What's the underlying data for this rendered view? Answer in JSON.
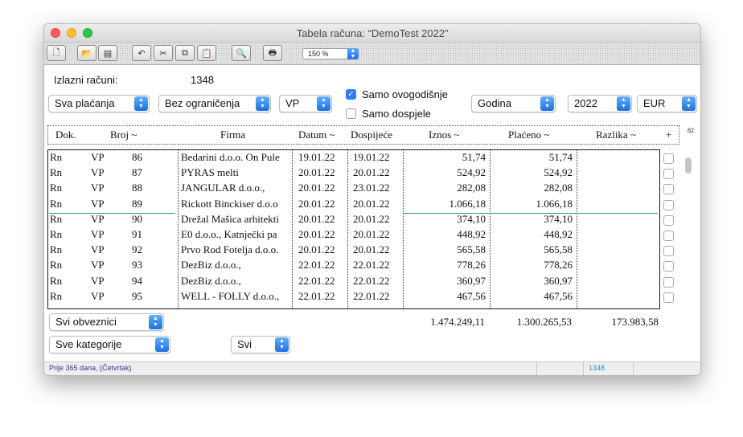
{
  "window": {
    "title": "Tabela računa: “DemoTest 2022”"
  },
  "toolbar": {
    "zoom": "150 %"
  },
  "summary": {
    "label": "Izlazni računi:",
    "count": "1348"
  },
  "filters": {
    "payment": "Sva plaćanja",
    "limit": "Bez ograničenja",
    "type": "VP",
    "period": "Godina",
    "year": "2022",
    "currency": "EUR",
    "cb_current_year": "Samo ovogodišnje",
    "cb_current_year_checked": true,
    "cb_due": "Samo dospjele",
    "cb_due_checked": false,
    "payers": "Svi obveznici",
    "categories": "Sve kategorije",
    "all": "Svi"
  },
  "columns": {
    "dok": "Dok.",
    "broj": "Broj ~",
    "firma": "Firma",
    "datum": "Datum ~",
    "dospijece": "Dospijeće",
    "iznos": "Iznos ~",
    "placeno": "Plaćeno ~",
    "razlika": "Razlika ~",
    "plus": "+",
    "count": "82"
  },
  "rows": [
    {
      "dok": "Rn",
      "vp": "VP",
      "broj": "86",
      "firma": "Bedarini d.o.o. On Pule",
      "datum": "19.01.22",
      "dosp": "19.01.22",
      "iznos": "51,74",
      "placeno": "51,74",
      "razlika": ""
    },
    {
      "dok": "Rn",
      "vp": "VP",
      "broj": "87",
      "firma": "PYRAS melti",
      "datum": "20.01.22",
      "dosp": "20.01.22",
      "iznos": "524,92",
      "placeno": "524,92",
      "razlika": ""
    },
    {
      "dok": "Rn",
      "vp": "VP",
      "broj": "88",
      "firma": "JANGULAR d.o.o.,",
      "datum": "20.01.22",
      "dosp": "23.01.22",
      "iznos": "282,08",
      "placeno": "282,08",
      "razlika": ""
    },
    {
      "dok": "Rn",
      "vp": "VP",
      "broj": "89",
      "firma": "Rickott Binckiser d.o.o",
      "datum": "20.01.22",
      "dosp": "20.01.22",
      "iznos": "1.066,18",
      "placeno": "1.066,18",
      "razlika": ""
    },
    {
      "dok": "Rn",
      "vp": "VP",
      "broj": "90",
      "firma": "Drežal Mašica arhitekti",
      "datum": "20.01.22",
      "dosp": "20.01.22",
      "iznos": "374,10",
      "placeno": "374,10",
      "razlika": ""
    },
    {
      "dok": "Rn",
      "vp": "VP",
      "broj": "91",
      "firma": "E0 d.o.o., Katnječki pa",
      "datum": "20.01.22",
      "dosp": "20.01.22",
      "iznos": "448,92",
      "placeno": "448,92",
      "razlika": ""
    },
    {
      "dok": "Rn",
      "vp": "VP",
      "broj": "92",
      "firma": "Prvo Rod Fotelja d.o.o.",
      "datum": "20.01.22",
      "dosp": "20.01.22",
      "iznos": "565,58",
      "placeno": "565,58",
      "razlika": ""
    },
    {
      "dok": "Rn",
      "vp": "VP",
      "broj": "93",
      "firma": "DezBiz d.o.o.,",
      "datum": "22.01.22",
      "dosp": "22.01.22",
      "iznos": "778,26",
      "placeno": "778,26",
      "razlika": ""
    },
    {
      "dok": "Rn",
      "vp": "VP",
      "broj": "94",
      "firma": "DezBiz d.o.o.,",
      "datum": "22.01.22",
      "dosp": "22.01.22",
      "iznos": "360,97",
      "placeno": "360,97",
      "razlika": ""
    },
    {
      "dok": "Rn",
      "vp": "VP",
      "broj": "95",
      "firma": "WELL - FOLLY d.o.o.,",
      "datum": "22.01.22",
      "dosp": "22.01.22",
      "iznos": "467,56",
      "placeno": "467,56",
      "razlika": ""
    }
  ],
  "totals": {
    "iznos": "1.474.249,11",
    "placeno": "1.300.265,53",
    "razlika": "173.983,58"
  },
  "status": {
    "left": "Prije 365 dana, (Četvrtak)",
    "right": "1348"
  },
  "colors": {
    "accent": "#2f7cf6",
    "status_left": "#3a2fa8",
    "status_right": "#1aa0d8",
    "selection_line": "#1e9aa0"
  }
}
